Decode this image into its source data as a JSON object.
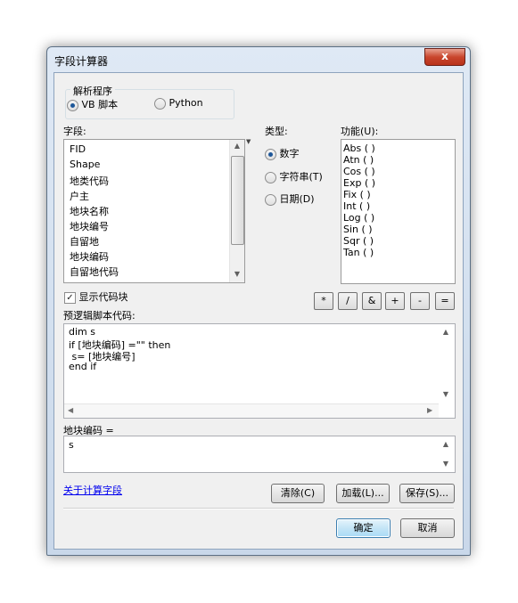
{
  "window": {
    "title": "字段计算器",
    "close_glyph": "x"
  },
  "parser": {
    "label": "解析程序",
    "options": [
      {
        "label": "VB 脚本",
        "selected": true
      },
      {
        "label": "Python",
        "selected": false
      }
    ]
  },
  "fields": {
    "label": "字段:",
    "items": [
      "FID",
      "Shape",
      "地类代码",
      "户主",
      "地块名称",
      "地块编号",
      "自留地",
      "地块编码",
      "自留地代码"
    ]
  },
  "types": {
    "label": "类型:",
    "options": [
      {
        "label": "数字",
        "selected": true
      },
      {
        "label": "字符串(T)",
        "selected": false
      },
      {
        "label": "日期(D)",
        "selected": false
      }
    ]
  },
  "functions": {
    "label": "功能(U):",
    "items": [
      "Abs ( )",
      "Atn ( )",
      "Cos ( )",
      "Exp ( )",
      "Fix ( )",
      "Int ( )",
      "Log ( )",
      "Sin ( )",
      "Sqr ( )",
      "Tan ( )"
    ]
  },
  "show_codeblock": {
    "label": "显示代码块",
    "checked": true,
    "check_glyph": "✓"
  },
  "operators": [
    "*",
    "/",
    "&",
    "+",
    "-",
    "="
  ],
  "prelogic": {
    "label": "预逻辑脚本代码:",
    "lines": [
      "dim s",
      "if [地块编码] =\"\" then",
      " s= [地块编号]",
      "end if"
    ]
  },
  "expression": {
    "label": "地块编码 =",
    "value": "s"
  },
  "help_link": "关于计算字段",
  "buttons": {
    "clear": "清除(C)",
    "load": "加载(L)...",
    "save": "保存(S)...",
    "ok": "确定",
    "cancel": "取消"
  }
}
